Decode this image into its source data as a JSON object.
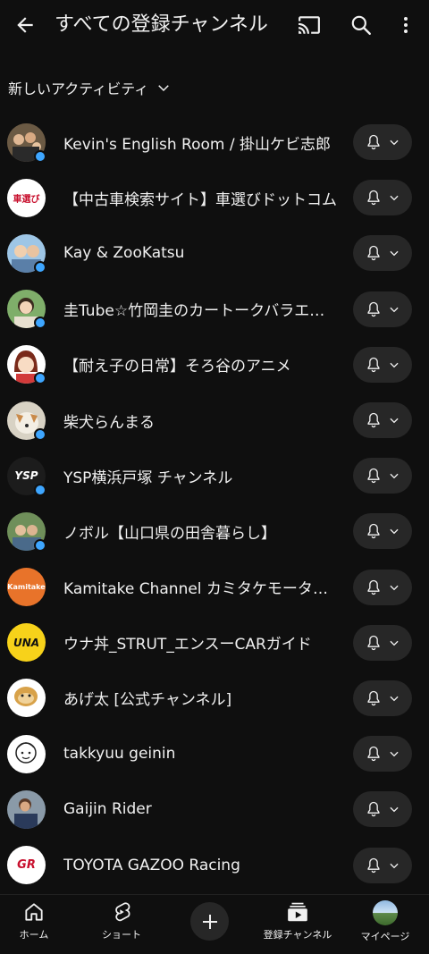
{
  "header": {
    "title": "すべての登録チャンネル",
    "back_icon": "arrow-left-icon",
    "cast_icon": "cast-icon",
    "search_icon": "search-icon",
    "more_icon": "more-vert-icon"
  },
  "filter": {
    "label": "新しいアクティビティ"
  },
  "channels": [
    {
      "name": "Kevin's English Room / 掛山ケビ志郎",
      "new": true
    },
    {
      "name": "【中古車検索サイト】車選びドットコム",
      "new": false
    },
    {
      "name": "Kay & ZooKatsu",
      "new": true
    },
    {
      "name": "圭Tube☆竹岡圭のカートークバラエティ",
      "new": true
    },
    {
      "name": "【耐え子の日常】そろ谷のアニメ",
      "new": true
    },
    {
      "name": "柴犬らんまる",
      "new": true
    },
    {
      "name": "YSP横浜戸塚 チャンネル",
      "new": true
    },
    {
      "name": "ノボル【山口県の田舎暮らし】",
      "new": true
    },
    {
      "name": "Kamitake Channel カミタケモータース",
      "new": false
    },
    {
      "name": "ウナ丼_STRUT_エンスーCARガイド",
      "new": false
    },
    {
      "name": "あげ太 [公式チャンネル]",
      "new": false
    },
    {
      "name": "takkyuu geinin",
      "new": false
    },
    {
      "name": "Gaijin Rider",
      "new": false
    },
    {
      "name": "TOYOTA GAZOO Racing",
      "new": false
    }
  ],
  "avatar_text": {
    "kurumaerabi": "車選び",
    "ysp": "YSP",
    "kamitake": "Kamitake",
    "una": "UNA",
    "gr": "GR"
  },
  "nav": {
    "home": "ホーム",
    "shorts": "ショート",
    "subscriptions": "登録チャンネル",
    "mypage": "マイページ"
  },
  "colors": {
    "background": "#0f0f0f",
    "pill": "#272727",
    "new_dot": "#3ea6ff",
    "text": "#f1f1f1"
  }
}
